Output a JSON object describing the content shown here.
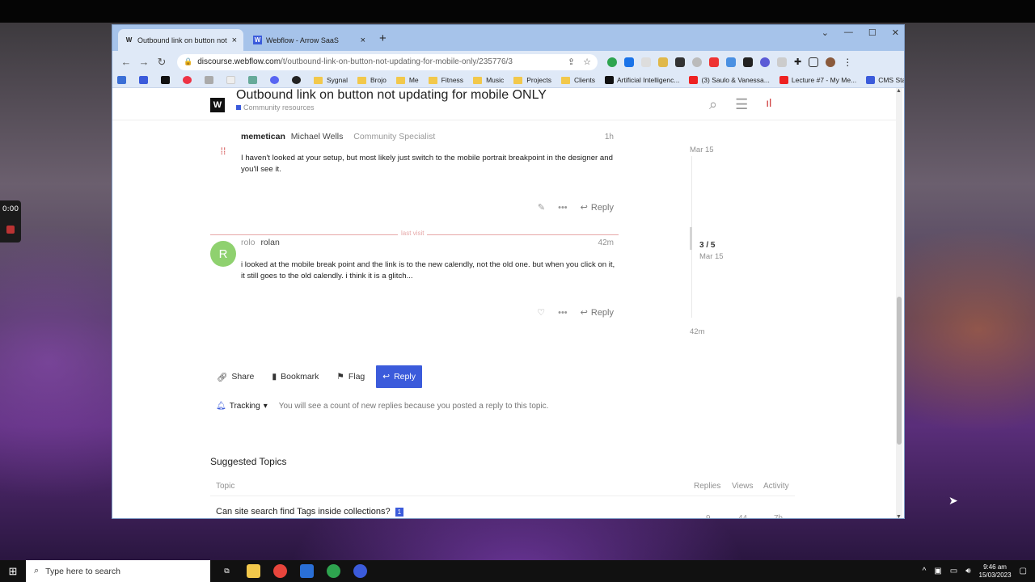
{
  "recorder": {
    "time": "0:00"
  },
  "tabs": [
    {
      "title": "Outbound link on button not upd",
      "favicon": "W"
    },
    {
      "title": "Webflow - Arrow SaaS",
      "favicon": "W"
    }
  ],
  "address": {
    "host": "discourse.webflow.com",
    "path": "/t/outbound-link-on-button-not-updating-for-mobile-only/235776/3"
  },
  "bookmarks": [
    "Sygnal",
    "Brojo",
    "Me",
    "Fitness",
    "Music",
    "Projects",
    "Clients",
    "Artificial Intelligenc...",
    "(3) Saulo & Vanessa...",
    "Lecture #7 - My Me...",
    "CMS Star Rating (N..."
  ],
  "header": {
    "title": "Outbound link on button not updating for mobile ONLY",
    "category": "Community resources"
  },
  "posts": [
    {
      "username": "memetican",
      "fullname": "Michael Wells",
      "user_title": "Community Specialist",
      "time": "1h",
      "text": "I haven't looked at your setup, but most likely just switch to the mobile portrait breakpoint in the designer and you'll see it.",
      "reply_label": "Reply"
    },
    {
      "username": "rolo",
      "fullname": "rolan",
      "avatar_letter": "R",
      "time": "42m",
      "text": "i looked at the mobile break point and the link is to the new calendly, not the old one. but when you click on it, it still goes to the old calendly. i think it is a glitch...",
      "reply_label": "Reply"
    }
  ],
  "last_visit": "last visit",
  "timeline": {
    "top_date": "Mar 15",
    "position": "3 / 5",
    "current_date": "Mar 15",
    "bottom": "42m"
  },
  "footer_buttons": {
    "share": "Share",
    "bookmark": "Bookmark",
    "flag": "Flag",
    "reply": "Reply"
  },
  "tracking": {
    "label": "Tracking",
    "reason": "You will see a count of new replies because you posted a reply to this topic."
  },
  "suggested": {
    "heading": "Suggested Topics",
    "columns": {
      "topic": "Topic",
      "replies": "Replies",
      "views": "Views",
      "activity": "Activity"
    },
    "rows": [
      {
        "title": "Can site search find Tags inside collections?",
        "badge": "1",
        "replies": "9",
        "views": "44",
        "activity": "7h"
      }
    ]
  },
  "taskbar": {
    "search_placeholder": "Type here to search",
    "time": "9:46 am",
    "date": "15/03/2023"
  },
  "colors": {
    "accent": "#3b5bdb",
    "last_visit": "#e6a8a8"
  }
}
